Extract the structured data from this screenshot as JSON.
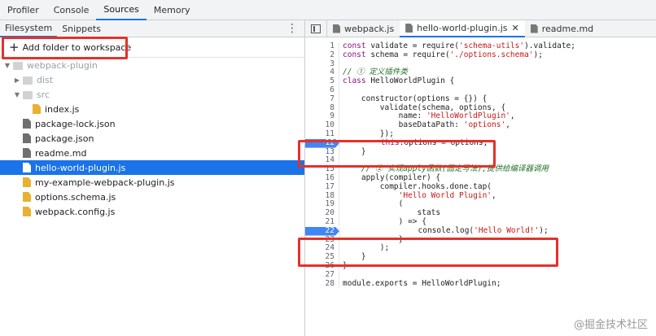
{
  "top_tabs": [
    "Profiler",
    "Console",
    "Sources",
    "Memory"
  ],
  "sidebar": {
    "tabs": [
      "Filesystem",
      "Snippets"
    ],
    "add_folder_label": "Add folder to workspace",
    "tree": [
      {
        "label": "webpack-plugin",
        "type": "folder",
        "depth": 0,
        "expanded": true,
        "dim": true
      },
      {
        "label": "dist",
        "type": "folder",
        "depth": 1,
        "expanded": false,
        "dim": true
      },
      {
        "label": "src",
        "type": "folder",
        "depth": 1,
        "expanded": true,
        "dim": true
      },
      {
        "label": "index.js",
        "type": "jsfile",
        "depth": 2
      },
      {
        "label": "package-lock.json",
        "type": "file",
        "depth": 1
      },
      {
        "label": "package.json",
        "type": "file",
        "depth": 1
      },
      {
        "label": "readme.md",
        "type": "file",
        "depth": 1
      },
      {
        "label": "hello-world-plugin.js",
        "type": "jsfile",
        "depth": 1,
        "selected": true
      },
      {
        "label": "my-example-webpack-plugin.js",
        "type": "jsfile",
        "depth": 1
      },
      {
        "label": "options.schema.js",
        "type": "jsfile",
        "depth": 1
      },
      {
        "label": "webpack.config.js",
        "type": "jsfile",
        "depth": 1
      }
    ]
  },
  "editor": {
    "tabs": [
      {
        "label": "webpack.js",
        "active": false,
        "closable": false
      },
      {
        "label": "hello-world-plugin.js",
        "active": true,
        "closable": true
      },
      {
        "label": "readme.md",
        "active": false,
        "closable": false
      }
    ],
    "lines": [
      {
        "n": "1",
        "code": "const validate = require('schema-utils').validate;"
      },
      {
        "n": "2",
        "code": "const schema = require('./options.schema');"
      },
      {
        "n": "3",
        "code": ""
      },
      {
        "n": "4",
        "code": "// ① 定义插件类",
        "comment": true
      },
      {
        "n": "5",
        "code": "class HelloWorldPlugin {"
      },
      {
        "n": "6",
        "code": ""
      },
      {
        "n": "7",
        "code": "    constructor(options = {}) {"
      },
      {
        "n": "8",
        "code": "        validate(schema, options, {"
      },
      {
        "n": "9",
        "code": "            name: 'HelloWorldPlugin',"
      },
      {
        "n": "10",
        "code": "            baseDataPath: 'options',"
      },
      {
        "n": "11",
        "code": "        });"
      },
      {
        "n": "12",
        "code": "        this.options = options;",
        "breakpoint": true
      },
      {
        "n": "13",
        "code": "    }"
      },
      {
        "n": "14",
        "code": ""
      },
      {
        "n": "15",
        "code": "    // ② 实现apply函数(固定写法),提供给编译器调用",
        "comment": true
      },
      {
        "n": "16",
        "code": "    apply(compiler) {"
      },
      {
        "n": "17",
        "code": "        compiler.hooks.done.tap("
      },
      {
        "n": "18",
        "code": "            'Hello World Plugin',"
      },
      {
        "n": "19",
        "code": "            ("
      },
      {
        "n": "20",
        "code": "                stats"
      },
      {
        "n": "21",
        "code": "            ) => {"
      },
      {
        "n": "22",
        "code": "                console.log('Hello World!');",
        "breakpoint": true
      },
      {
        "n": "23",
        "code": "            }"
      },
      {
        "n": "24",
        "code": "        );"
      },
      {
        "n": "25",
        "code": "    }"
      },
      {
        "n": "26",
        "code": "}"
      },
      {
        "n": "27",
        "code": ""
      },
      {
        "n": "28",
        "code": "module.exports = HelloWorldPlugin;"
      }
    ]
  },
  "watermark": "@掘金技术社区",
  "colors": {
    "accent": "#1a73e8",
    "highlight_box": "#e5312a",
    "breakpoint": "#4285f4"
  }
}
